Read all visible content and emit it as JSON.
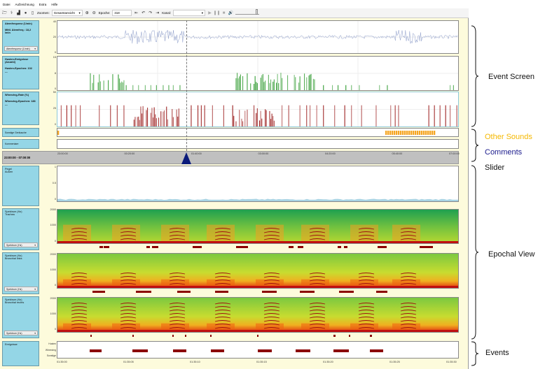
{
  "menu": [
    "Datei",
    "Aufzeichnung",
    "Extra",
    "Hilfe"
  ],
  "toolbar": {
    "zoom_label": "Zoomen:",
    "zoom_value": "Gesamtansicht",
    "epoch_label": "Epoche:",
    "epoch_value": "318",
    "channel_label": "Kanal:",
    "channel_value": ""
  },
  "event_screen": {
    "breath": {
      "title": "Atemfrequenz (1/min)",
      "stat": "Mittl. Atemfreq.: 18,2 /min",
      "dropdown": "Atemfrequenz (1/min)",
      "yticks": [
        "40",
        "20",
        "0"
      ]
    },
    "cough": {
      "title": "Husten-Ereignisse (Anzahl)",
      "stat": "Husten-Epochen: 102",
      "extra": "---",
      "yticks": [
        "15",
        "8",
        "0"
      ]
    },
    "wheeze": {
      "title": "Wheezing-Rate (%)",
      "stat": "Wheezing-Epochen: 183",
      "extra": "---",
      "yticks": [
        "50",
        "25",
        "0"
      ]
    },
    "other_sounds": {
      "title": "Sonstige Geräusche"
    },
    "comments": {
      "title": "Kommentare"
    }
  },
  "slider": {
    "range": "23:00:00 - 07:00:00",
    "ticks": [
      "23:00:00",
      "00:20:00",
      "01:40:00",
      "03:00:00",
      "04:20:00",
      "05:40:00",
      "07:00:00"
    ]
  },
  "epochal": {
    "level": {
      "title": "Pegel",
      "subtitle": "Außen",
      "yticks": [
        "1",
        "0.5",
        "0"
      ]
    },
    "spec1": {
      "title": "Spektrum (Hz)",
      "subtitle": "Trachea",
      "dropdown": "Spektrum (Hz)",
      "yticks": [
        "2000",
        "1000",
        "0"
      ]
    },
    "spec2": {
      "title": "Spektrum (Hz)",
      "subtitle": "Bronchial links",
      "dropdown": "Spektrum (Hz)",
      "yticks": [
        "2000",
        "1000",
        "0"
      ]
    },
    "spec3": {
      "title": "Spektrum (Hz)",
      "subtitle": "Bronchial rechts",
      "dropdown": "Spektrum (Hz)",
      "yticks": [
        "2000",
        "1000",
        "0"
      ]
    }
  },
  "events": {
    "title": "Ereignisse",
    "rows": [
      "Husten",
      "Wheezing",
      "Sonstige"
    ],
    "ticks": [
      "01:35:00",
      "01:35:05",
      "01:35:10",
      "01:35:15",
      "01:35:20",
      "01:35:25",
      "01:35:30"
    ]
  },
  "annotations": {
    "event_screen": "Event Screen",
    "other_sounds": "Other Sounds",
    "comments": "Comments",
    "slider": "Slider",
    "epochal_view": "Epochal View",
    "events": "Events"
  },
  "colors": {
    "panel": "#94d6e6",
    "background": "#fdfbdc",
    "cough": "#2e9a2e",
    "wheeze": "#9b1c1c",
    "other_sounds": "#f5a623",
    "comments_text": "#1a1a8c",
    "other_text": "#f5b800",
    "slider_thumb": "#0a1a7a"
  }
}
